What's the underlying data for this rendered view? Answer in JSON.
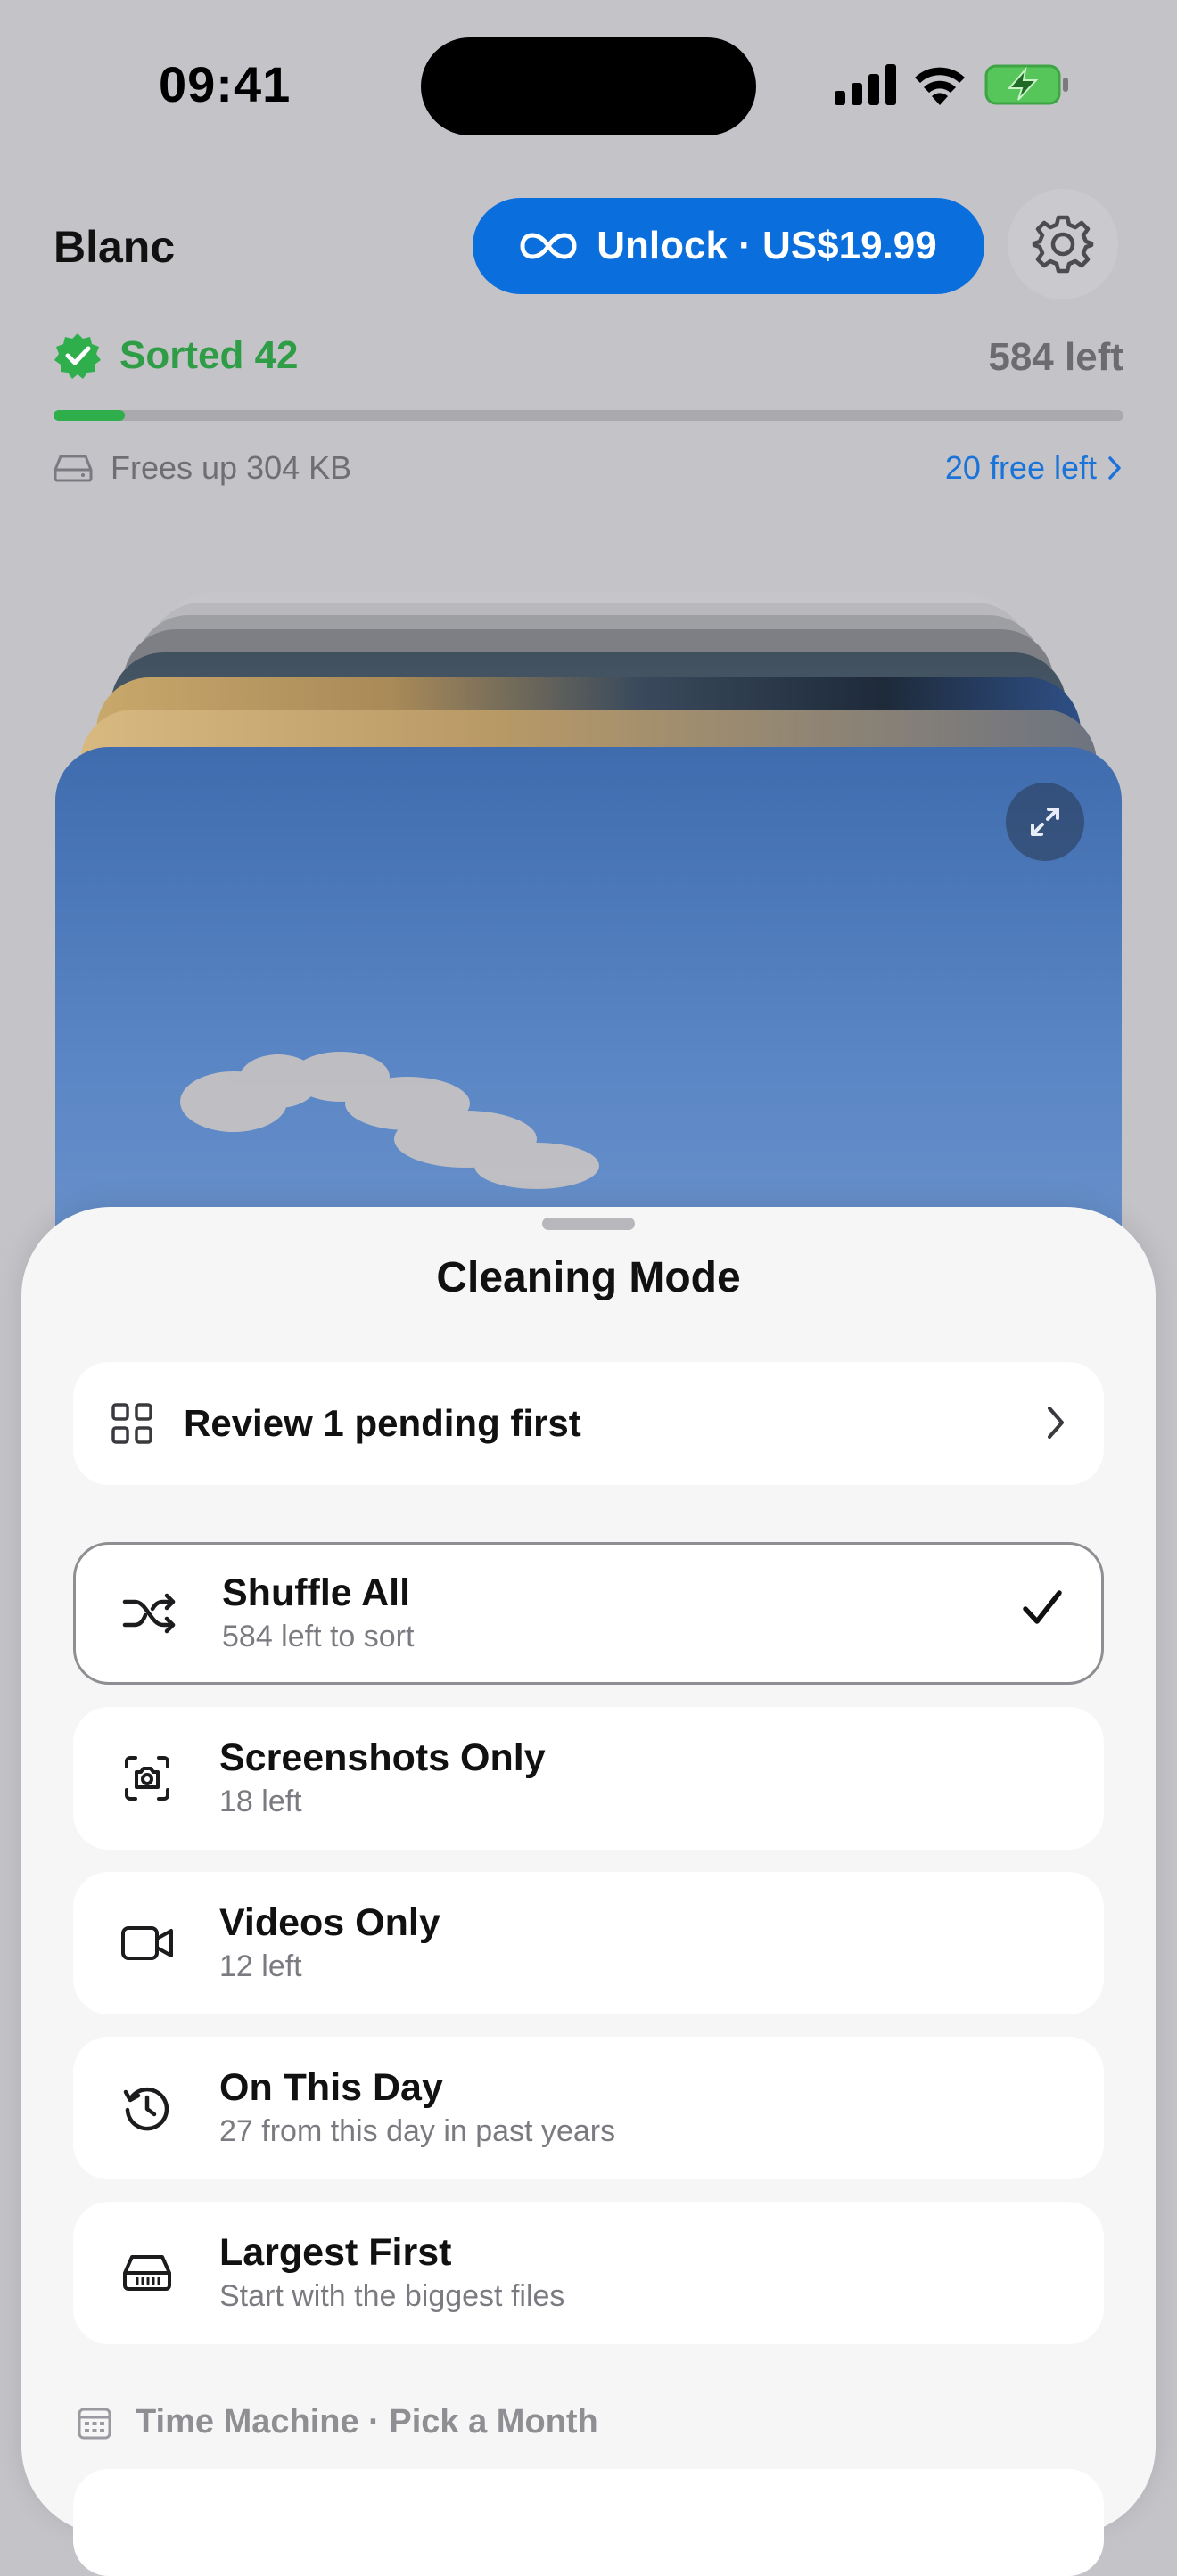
{
  "status_bar": {
    "time": "09:41"
  },
  "header": {
    "app_name": "Blanc",
    "unlock_label": "Unlock · US$19.99",
    "settings_icon": "gear-icon"
  },
  "progress": {
    "sorted_label": "Sorted 42",
    "left_label": "584 left",
    "fraction": 0.067,
    "frees_label": "Frees up 304 KB",
    "free_left_label": "20 free left"
  },
  "colors": {
    "accent": "#0a6fdc",
    "success": "#2fae4c",
    "link": "#1a73d9"
  },
  "sheet": {
    "title": "Cleaning Mode",
    "pending_label": "Review 1 pending first",
    "options": [
      {
        "title": "Shuffle All",
        "subtitle": "584 left to sort",
        "icon": "shuffle-icon",
        "selected": true
      },
      {
        "title": "Screenshots Only",
        "subtitle": "18 left",
        "icon": "screenshot-icon",
        "selected": false
      },
      {
        "title": "Videos Only",
        "subtitle": "12 left",
        "icon": "video-icon",
        "selected": false
      },
      {
        "title": "On This Day",
        "subtitle": "27 from this day in past years",
        "icon": "history-icon",
        "selected": false
      },
      {
        "title": "Largest First",
        "subtitle": "Start with the biggest files",
        "icon": "drive-icon",
        "selected": false
      }
    ],
    "time_machine_label": "Time Machine · Pick a Month"
  }
}
